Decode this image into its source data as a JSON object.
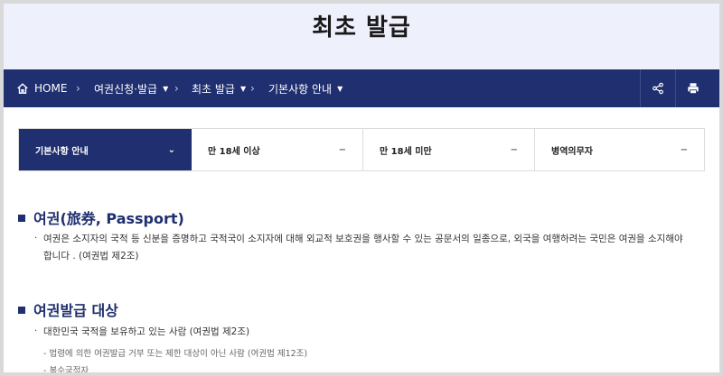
{
  "page_title": "최초 발급",
  "breadcrumb": [
    {
      "label": "HOME"
    },
    {
      "label": "여권신청·발급"
    },
    {
      "label": "최초 발급"
    },
    {
      "label": "기본사항 안내"
    }
  ],
  "tabs": [
    {
      "label": "기본사항 안내",
      "mark": "⌄"
    },
    {
      "label": "만 18세 이상",
      "mark": "−"
    },
    {
      "label": "만 18세 미만",
      "mark": "−"
    },
    {
      "label": "병역의무자",
      "mark": "−"
    }
  ],
  "sections": [
    {
      "title": "여권(旅券, Passport)",
      "body_line1": "여권은 소지자의 국적 등 신분을 증명하고 국적국이 소지자에 대해 외교적 보호권을 행사할 수 있는 공문서의 일종으로, 외국을 여행하려는 국민은 여권을 소지해야",
      "body_line2": "합니다 . (여권법 제2조)"
    },
    {
      "title": "여권발급 대상",
      "main_item": "대한민국 국적을 보유하고 있는 사람 (여권법 제2조)",
      "sub_items": [
        "법령에 의한 여권발급 거부 또는 제한 대상이 아닌 사람 (여권법 제12조)",
        "복수국적자"
      ]
    }
  ],
  "colors": {
    "nav_bg": "#1f2f6f",
    "hero_bg": "#eef0fb",
    "accent": "#1f2f6f"
  }
}
